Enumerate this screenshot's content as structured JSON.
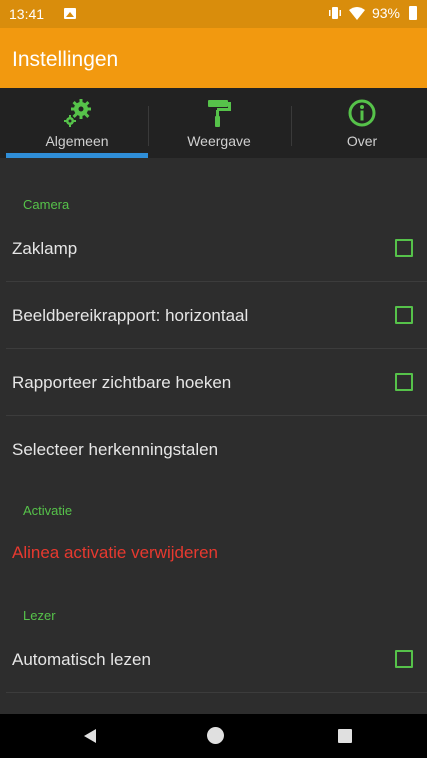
{
  "status_bar": {
    "time": "13:41",
    "battery": "93%",
    "icons": [
      "photo-icon",
      "vibrate-icon",
      "wifi-icon",
      "battery-icon"
    ]
  },
  "app_bar": {
    "title": "Instellingen"
  },
  "tabs": [
    {
      "label": "Algemeen",
      "icon": "gears-icon",
      "selected": true
    },
    {
      "label": "Weergave",
      "icon": "paint-roller-icon",
      "selected": false
    },
    {
      "label": "Over",
      "icon": "info-icon",
      "selected": false
    }
  ],
  "sections": {
    "camera": {
      "title": "Camera",
      "items": [
        {
          "label": "Zaklamp",
          "checked": false
        },
        {
          "label": "Beeldbereikrapport: horizontaal",
          "checked": false
        },
        {
          "label": "Rapporteer zichtbare hoeken",
          "checked": false
        },
        {
          "label": "Selecteer herkenningstalen"
        }
      ]
    },
    "activatie": {
      "title": "Activatie",
      "items": [
        {
          "label": "Alinea activatie verwijderen"
        }
      ]
    },
    "lezer": {
      "title": "Lezer",
      "items": [
        {
          "label": "Automatisch lezen",
          "checked": false
        }
      ]
    }
  },
  "colors": {
    "status_bar": "#d98d0c",
    "app_bar": "#f2990f",
    "accent_green": "#56c24a",
    "tab_indicator": "#2f8ed8",
    "danger_text": "#e7392f",
    "background": "#2d2d2d"
  }
}
